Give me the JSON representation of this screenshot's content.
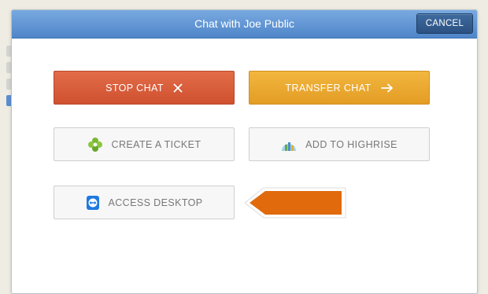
{
  "modal": {
    "title": "Chat with Joe Public",
    "cancel_label": "CANCEL"
  },
  "actions": {
    "stop_chat": {
      "label": "STOP CHAT",
      "icon": "close-x-icon",
      "color": "#d95a38"
    },
    "transfer_chat": {
      "label": "TRANSFER CHAT",
      "icon": "arrow-right-icon",
      "color": "#eaa730"
    },
    "create_ticket": {
      "label": "CREATE A TICKET",
      "icon": "zendesk-clover-icon"
    },
    "add_to_highrise": {
      "label": "ADD TO HIGHRISE",
      "icon": "highrise-icon"
    },
    "access_desktop": {
      "label": "ACCESS DESKTOP",
      "icon": "teamviewer-icon"
    }
  },
  "colors": {
    "header_blue": "#5b8fd0",
    "pointer_orange": "#e06a0c"
  }
}
